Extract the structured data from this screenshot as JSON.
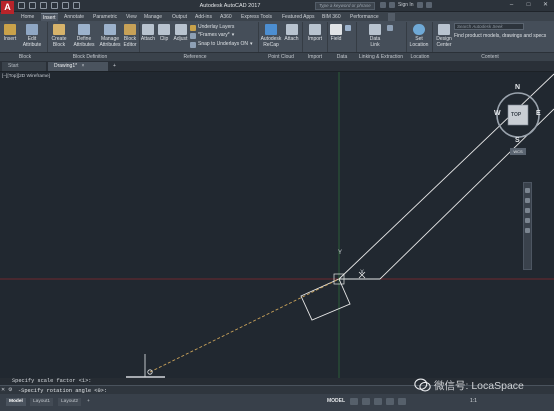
{
  "app": {
    "logo": "A",
    "title": "Autodesk AutoCAD 2017"
  },
  "title_bar": {
    "search_placeholder": "Type a keyword or phrase",
    "sign_in": "Sign In",
    "window_controls": [
      "–",
      "□",
      "✕"
    ]
  },
  "ribbon_tabs": [
    "Home",
    "Insert",
    "Annotate",
    "Parametric",
    "View",
    "Manage",
    "Output",
    "Add-ins",
    "A360",
    "Express Tools",
    "Featured Apps",
    "BIM 360",
    "Performance"
  ],
  "active_tab": "Insert",
  "ribbon": {
    "buttons": {
      "insert": "Insert",
      "edit_attribute": [
        "Edit",
        "Attribute"
      ],
      "create_block": [
        "Create",
        "Block"
      ],
      "define_attributes": [
        "Define",
        "Attributes"
      ],
      "manage_attributes": [
        "Manage",
        "Attributes"
      ],
      "block_editor": [
        "Block",
        "Editor"
      ],
      "attach": "Attach",
      "clip": "Clip",
      "adjust": "Adjust",
      "underlay_layers": "Underlay Layers",
      "frames_vary": "*Frames vary*",
      "snap_to_underlays": "Snap to Underlays ON",
      "autodesk_recap": [
        "Autodesk",
        "ReCap"
      ],
      "attach_pc": "Attach",
      "import": "Import",
      "field": "Field",
      "data_link": [
        "Data",
        "Link"
      ],
      "set_location": [
        "Set",
        "Location"
      ],
      "design_center": [
        "Design",
        "Center"
      ]
    },
    "content_search_placeholder": "Search Autodesk Seek",
    "content_text": "Find product models, drawings and specs",
    "groups": [
      "Block",
      "Block Definition",
      "Reference",
      "Point Cloud",
      "Import",
      "Data",
      "Linking & Extraction",
      "Location",
      "Content"
    ]
  },
  "file_tabs": {
    "start": "Start",
    "drawing": "Drawing1*",
    "close": "×",
    "add": "+"
  },
  "viewport": {
    "controls": "[–][Top][2D Wireframe]",
    "viewcube": {
      "face": "TOP",
      "north": "N",
      "south": "S",
      "east": "E",
      "west": "W",
      "wcs": "WCS"
    },
    "ucs_y": "Y",
    "ucs_x": "X"
  },
  "command": {
    "history": "Specify scale factor <1>:",
    "prompt_value": "-Specify rotation angle <0>:"
  },
  "layout_tabs": [
    "Model",
    "Layout1",
    "Layout2",
    "+"
  ],
  "status": {
    "model": "MODEL",
    "scale": "1:1"
  },
  "watermark": "微信号: LocaSpace",
  "colors": {
    "background": "#212830",
    "ribbon": "#454e59",
    "crosshair_x": "#8a2a2e",
    "crosshair_y": "#2f6b3a",
    "geometry": "#e8e8e8",
    "dashed": "#c9a25a",
    "accent_logo": "#b8242a"
  }
}
